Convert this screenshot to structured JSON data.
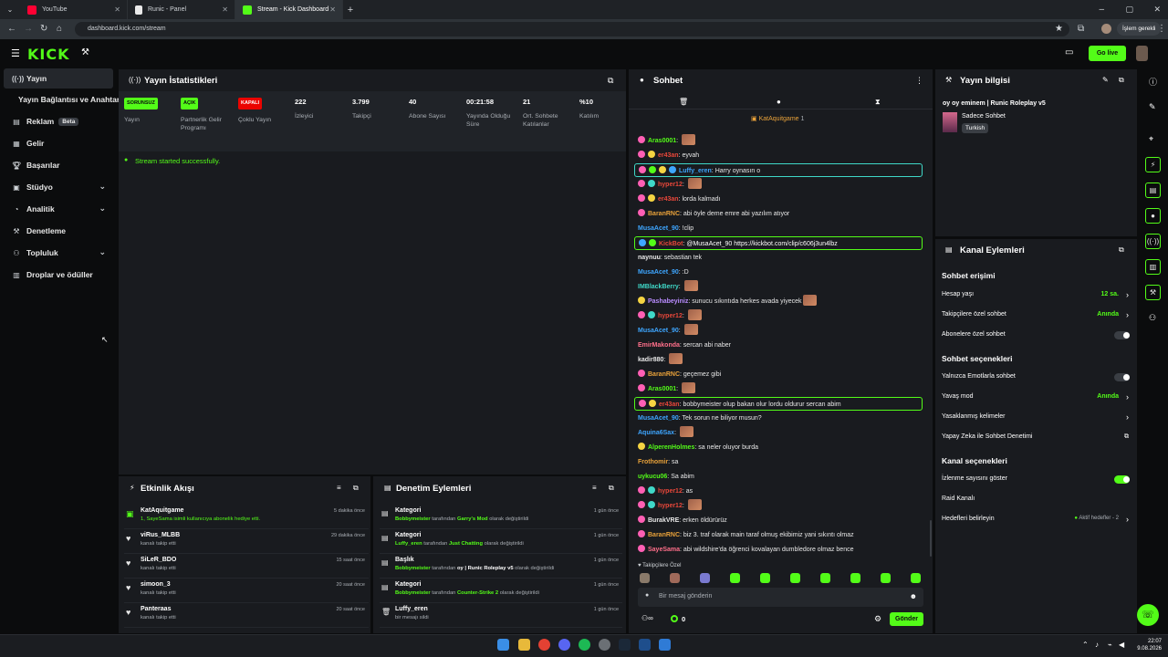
{
  "browser": {
    "tabs": [
      {
        "label": "YouTube",
        "color": "#ff0033"
      },
      {
        "label": "Runic - Panel",
        "color": "#e9e9e9"
      },
      {
        "label": "Stream - Kick Dashboard",
        "color": "#53fc18"
      }
    ],
    "url": "dashboard.kick.com/stream",
    "profile_label": "İşlem gerekli"
  },
  "app": {
    "logo_text": "KICK",
    "go_live_label": "Go live",
    "accent": "#53fc18"
  },
  "sidebar": {
    "items": [
      {
        "label": "Yayın",
        "icon": "stream-icon"
      },
      {
        "label": "Yayın Bağlantısı ve Anahtarı",
        "icon": ""
      },
      {
        "label": "Reklam",
        "icon": "ads-icon",
        "badge": "Beta"
      },
      {
        "label": "Gelir",
        "icon": "revenue-icon"
      },
      {
        "label": "Başarılar",
        "icon": "trophy-icon"
      },
      {
        "label": "Stüdyo",
        "icon": "studio-icon"
      },
      {
        "label": "Analitik",
        "icon": "analytics-icon"
      },
      {
        "label": "Denetleme",
        "icon": "moderation-icon"
      },
      {
        "label": "Topluluk",
        "icon": "community-icon"
      },
      {
        "label": "Droplar ve ödüller",
        "icon": "drops-icon"
      }
    ]
  },
  "stats": {
    "title": "Yayın İstatistikleri",
    "items": [
      {
        "badge": "SORUNSUZ",
        "badge_color": "#53fc18",
        "label": "Yayın"
      },
      {
        "badge": "AÇIK",
        "badge_color": "#53fc18",
        "label": "Partnerlik Gelir Programı"
      },
      {
        "badge": "KAPALI",
        "badge_color": "#eb0400",
        "label": "Çoklu Yayın"
      },
      {
        "value": "222",
        "label": "İzleyici"
      },
      {
        "value": "3.799",
        "label": "Takipçi"
      },
      {
        "value": "40",
        "label": "Abone Sayısı"
      },
      {
        "value": "00:21:58",
        "label": "Yayında Olduğu Süre"
      },
      {
        "value": "21",
        "label": "Ort. Sohbete Katılanlar"
      },
      {
        "value": "%10",
        "label": "Katılım"
      }
    ],
    "success_message": "Stream started successfully."
  },
  "activity": {
    "title": "Etkinlik Akışı",
    "rows": [
      {
        "name": "KatAquitgame",
        "desc": "1, SayeSama isimli kullanıcıya abonelik hediye etti.",
        "time": "5 dakika önce",
        "icon": "gift-icon"
      },
      {
        "name": "viRus_MLBB",
        "desc": "kanalı takip etti",
        "time": "29 dakika önce",
        "icon": "heart-icon"
      },
      {
        "name": "SiLeR_BDO",
        "desc": "kanalı takip etti",
        "time": "15 saat önce",
        "icon": "heart-icon"
      },
      {
        "name": "simoon_3",
        "desc": "kanalı takip etti",
        "time": "20 saat önce",
        "icon": "heart-icon"
      },
      {
        "name": "Panteraas",
        "desc": "kanalı takip etti",
        "time": "20 saat önce",
        "icon": "heart-icon"
      }
    ]
  },
  "moderation": {
    "title": "Denetim Eylemleri",
    "rows": [
      {
        "title": "Kategori",
        "who": "Bobbymeister",
        "mid": " tarafından ",
        "what": "Garry's Mod",
        "end": " olarak değiştirildi",
        "time": "1 gün önce",
        "icon": "edit-icon"
      },
      {
        "title": "Kategori",
        "who": "Luffy_eren",
        "mid": " tarafından ",
        "what": "Just Chatting",
        "end": " olarak değiştirildi",
        "time": "1 gün önce",
        "icon": "edit-icon"
      },
      {
        "title": "Başlık",
        "who": "Bobbymeister",
        "mid": " tarafından ",
        "what": "oy | Runic Roleplay v5",
        "end": " olarak değiştirildi",
        "time": "1 gün önce",
        "icon": "edit-icon"
      },
      {
        "title": "Kategori",
        "who": "Bobbymeister",
        "mid": " tarafından ",
        "what": "Counter-Strike 2",
        "end": " olarak değiştirildi",
        "time": "1 gün önce",
        "icon": "edit-icon"
      },
      {
        "title": "Luffy_eren",
        "who": "",
        "mid": "bir mesajı sildi",
        "what": "",
        "end": "",
        "time": "1 gün önce",
        "icon": "trash-icon"
      }
    ]
  },
  "chat": {
    "title": "Sohbet",
    "pinned": "KatAquitgame",
    "pinned_count": "1",
    "messages": [
      {
        "user": "Aras0001",
        "color": "#53fc18",
        "text": "",
        "emote": true,
        "b": [
          "#ff5fb4"
        ]
      },
      {
        "user": "er43an",
        "color": "#e9473a",
        "text": "eyvah",
        "emote": false,
        "b": [
          "#ff5fb4",
          "#f5d442"
        ]
      },
      {
        "user": "Luffy_eren",
        "color": "#3ea6ff",
        "text": "Harry oynasın o",
        "emote": false,
        "b": [
          "#ff5fb4",
          "#53fc18",
          "#f5d442",
          "#3ea6ff"
        ],
        "hl": "blue"
      },
      {
        "user": "hyper12",
        "color": "#e9473a",
        "text": "",
        "emote": true,
        "b": [
          "#ff5fb4",
          "#3fd8c8"
        ]
      },
      {
        "user": "er43an",
        "color": "#e9473a",
        "text": "lorda kalmadı",
        "emote": false,
        "b": [
          "#ff5fb4",
          "#f5d442"
        ]
      },
      {
        "user": "BaranRNC",
        "color": "#e9a23a",
        "text": "abi öyle deme emre abi yazılım atıyor",
        "emote": false,
        "b": [
          "#ff5fb4"
        ]
      },
      {
        "user": "MusaAcet_90",
        "color": "#3ea6ff",
        "text": "!clip",
        "emote": false,
        "b": []
      },
      {
        "user": "KickBot",
        "color": "#e9473a",
        "text": "@MusaAcet_90 https://kickbot.com/clip/c606j3un4lbz",
        "emote": false,
        "b": [
          "#3ea6ff",
          "#53fc18"
        ],
        "hl": "green"
      },
      {
        "user": "naynuu",
        "color": "#e8e8e8",
        "text": "sebastian tek",
        "emote": false,
        "b": []
      },
      {
        "user": "MusaAcet_90",
        "color": "#3ea6ff",
        "text": ":D",
        "emote": false,
        "b": []
      },
      {
        "user": "IMBlackBerry",
        "color": "#3fd8c8",
        "text": "",
        "emote": true,
        "b": []
      },
      {
        "user": "Pashabeyiniz",
        "color": "#b98cff",
        "text": "sunucu sıkıntıda herkes avada yiyecek",
        "emote": true,
        "b": [
          "#f5d442"
        ]
      },
      {
        "user": "hyper12",
        "color": "#e9473a",
        "text": "",
        "emote": true,
        "b": [
          "#ff5fb4",
          "#3fd8c8"
        ]
      },
      {
        "user": "MusaAcet_90",
        "color": "#3ea6ff",
        "text": "",
        "emote": true,
        "b": []
      },
      {
        "user": "EmirMakonda",
        "color": "#ff6f8a",
        "text": "sercan abi naber",
        "emote": false,
        "b": []
      },
      {
        "user": "kadir880",
        "color": "#e8e8e8",
        "text": "",
        "emote": true,
        "b": []
      },
      {
        "user": "BaranRNC",
        "color": "#e9a23a",
        "text": "geçemez gibi",
        "emote": false,
        "b": [
          "#ff5fb4"
        ]
      },
      {
        "user": "Aras0001",
        "color": "#53fc18",
        "text": "",
        "emote": true,
        "b": [
          "#ff5fb4"
        ]
      },
      {
        "user": "er43an",
        "color": "#e9473a",
        "text": "bobbymeister olup bakan olur lordu oldurur sercan abim",
        "emote": false,
        "b": [
          "#ff5fb4",
          "#f5d442"
        ],
        "hl": "green"
      },
      {
        "user": "MusaAcet_90",
        "color": "#3ea6ff",
        "text": "Tek sorun ne biliyor musun?",
        "emote": false,
        "b": []
      },
      {
        "user": "Aquina6Sax",
        "color": "#3ea6ff",
        "text": "",
        "emote": true,
        "b": []
      },
      {
        "user": "AlperenHolmes",
        "color": "#53fc18",
        "text": "sa neler oluyor burda",
        "emote": false,
        "b": [
          "#f5d442"
        ]
      },
      {
        "user": "Frothomir",
        "color": "#e9a23a",
        "text": "sa",
        "emote": false,
        "b": []
      },
      {
        "user": "uykucu06",
        "color": "#53fc18",
        "text": "Sa abim",
        "emote": false,
        "b": []
      },
      {
        "user": "hyper12",
        "color": "#e9473a",
        "text": "as",
        "emote": false,
        "b": [
          "#ff5fb4",
          "#3fd8c8"
        ]
      },
      {
        "user": "hyper12",
        "color": "#e9473a",
        "text": "",
        "emote": true,
        "b": [
          "#ff5fb4",
          "#3fd8c8"
        ]
      },
      {
        "user": "BurakVRE",
        "color": "#e8e8e8",
        "text": "erken öldürürüz",
        "emote": false,
        "b": [
          "#ff5fb4"
        ]
      },
      {
        "user": "BaranRNC",
        "color": "#e9a23a",
        "text": "biz 3. traf olarak main taraf olmuş ekibimiz yani sıkıntı olmaz",
        "emote": false,
        "b": [
          "#ff5fb4"
        ]
      },
      {
        "user": "SayeSama",
        "color": "#ff6f8a",
        "text": "abi wildshire'da öğrenci kovalayan dumbledore olmaz bence",
        "emote": false,
        "b": [
          "#ff5fb4"
        ]
      }
    ],
    "followers_label": "Takipçilere Özel",
    "input_placeholder": "Bir mesaj gönderin",
    "send_label": "Gönder",
    "points_value": "0"
  },
  "stream_info": {
    "title": "Yayın bilgisi",
    "stream_title": "oy oy eminem | Runic Roleplay v5",
    "category": "Sadece Sohbet",
    "language": "Turkish"
  },
  "channel_actions": {
    "title": "Kanal Eylemleri",
    "chat_access": "Sohbet erişimi",
    "account_age": {
      "label": "Hesap yaşı",
      "value": "12 sa."
    },
    "followers_only": {
      "label": "Takipçilere özel sohbet",
      "value": "Anında"
    },
    "subs_only": {
      "label": "Abonelere özel sohbet"
    },
    "chat_options": "Sohbet seçenekleri",
    "emote_only": {
      "label": "Yalnızca Emotlarla sohbet"
    },
    "slow_mode": {
      "label": "Yavaş mod",
      "value": "Anında"
    },
    "banned_words": {
      "label": "Yasaklanmış kelimeler"
    },
    "ai_moderation": {
      "label": "Yapay Zeka ile Sohbet Denetimi"
    },
    "channel_options": "Kanal seçenekleri",
    "show_viewers": {
      "label": "İzlenme sayısını göster"
    },
    "raid": {
      "label": "Raid Kanalı"
    },
    "goals": {
      "label": "Hedefleri belirleyin",
      "value": "Aktif hedefler - 2"
    }
  },
  "taskbar": {
    "time": "22:07",
    "date": "9.08.2026"
  }
}
